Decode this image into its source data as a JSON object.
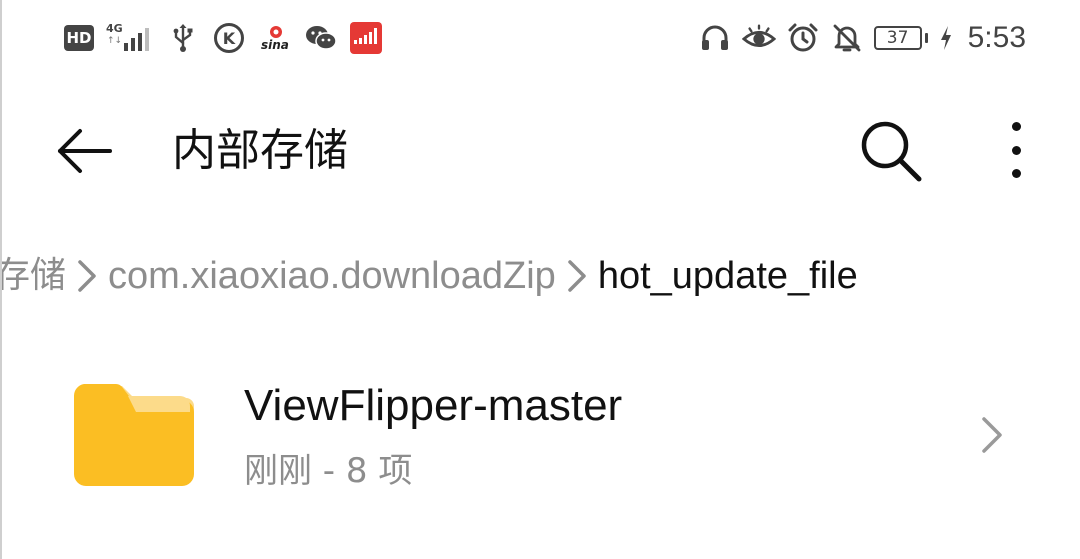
{
  "status_bar": {
    "hd_label": "HD",
    "network_label": "4G",
    "network_arrows": "↑↓",
    "battery_level": "37",
    "time": "5:53",
    "left_icons": [
      "hd-badge",
      "signal-4g-icon",
      "usb-icon",
      "k-app-icon",
      "sina-icon",
      "wechat-icon",
      "red-app-icon"
    ],
    "right_icons": [
      "headset-icon",
      "eye-icon",
      "alarm-icon",
      "bell-off-icon",
      "battery-icon",
      "charging-bolt-icon"
    ]
  },
  "app_bar": {
    "title": "内部存储",
    "back_icon": "arrow-left-icon",
    "search_icon": "search-icon",
    "more_icon": "more-vertical-icon"
  },
  "breadcrumb": {
    "items": [
      "存储",
      "com.xiaoxiao.downloadZip",
      "hot_update_file"
    ],
    "separator_icon": "chevron-right-icon"
  },
  "files": [
    {
      "name": "ViewFlipper-master",
      "meta": "刚刚 - 8 项",
      "icon": "folder-icon",
      "icon_color": "#FBBE23"
    }
  ],
  "colors": {
    "primary_text": "#111111",
    "secondary_text": "#8D8D8D",
    "folder": "#FBBE23",
    "folder_tab": "#FCDB8A",
    "status_icons": "#444444"
  }
}
